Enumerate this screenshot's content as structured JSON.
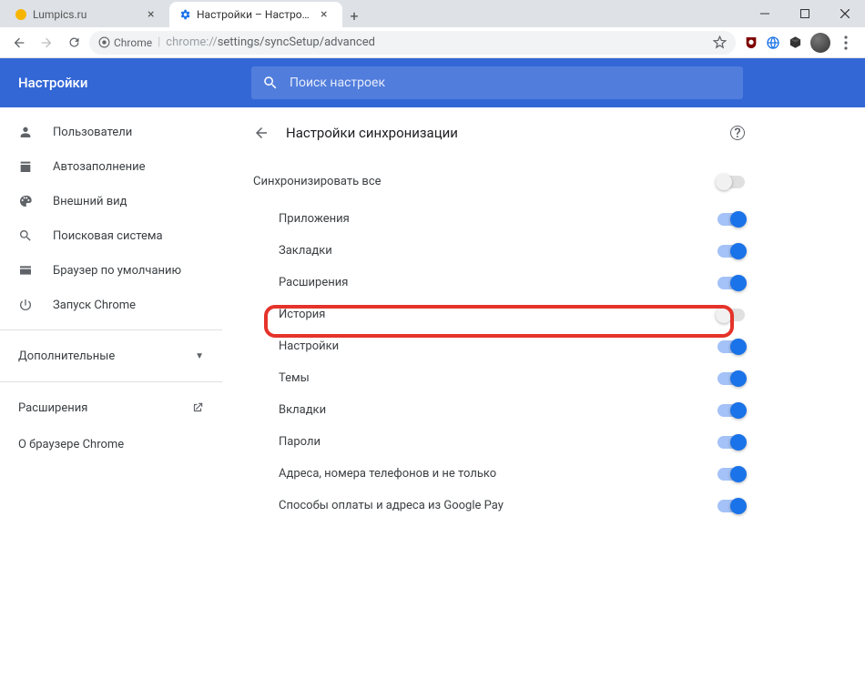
{
  "window": {
    "tabs": [
      {
        "title": "Lumpics.ru",
        "favicon": "lumpics",
        "active": false
      },
      {
        "title": "Настройки – Настройки синхро",
        "favicon": "gear",
        "active": true
      }
    ]
  },
  "addrbar": {
    "secure_label": "Chrome",
    "url_scheme": "chrome://",
    "url_path": "settings/syncSetup/advanced"
  },
  "settings": {
    "title": "Настройки",
    "search_placeholder": "Поиск настроек"
  },
  "sidebar": {
    "items": [
      {
        "icon": "person",
        "label": "Пользователи"
      },
      {
        "icon": "autofill",
        "label": "Автозаполнение"
      },
      {
        "icon": "palette",
        "label": "Внешний вид"
      },
      {
        "icon": "search",
        "label": "Поисковая система"
      },
      {
        "icon": "browser",
        "label": "Браузер по умолчанию"
      },
      {
        "icon": "power",
        "label": "Запуск Chrome"
      }
    ],
    "advanced": "Дополнительные",
    "extensions": "Расширения",
    "about": "О браузере Chrome"
  },
  "page": {
    "title": "Настройки синхронизации",
    "master_label": "Синхронизировать все",
    "rows": {
      "apps": "Приложения",
      "bookmarks": "Закладки",
      "extensions": "Расширения",
      "history": "История",
      "settings": "Настройки",
      "themes": "Темы",
      "tabs": "Вкладки",
      "passwords": "Пароли",
      "addresses": "Адреса, номера телефонов и не только",
      "payments": "Способы оплаты и адреса из Google Pay"
    }
  },
  "colors": {
    "accent": "#1a73e8",
    "header": "#3367d6",
    "highlight": "#e5332a"
  }
}
